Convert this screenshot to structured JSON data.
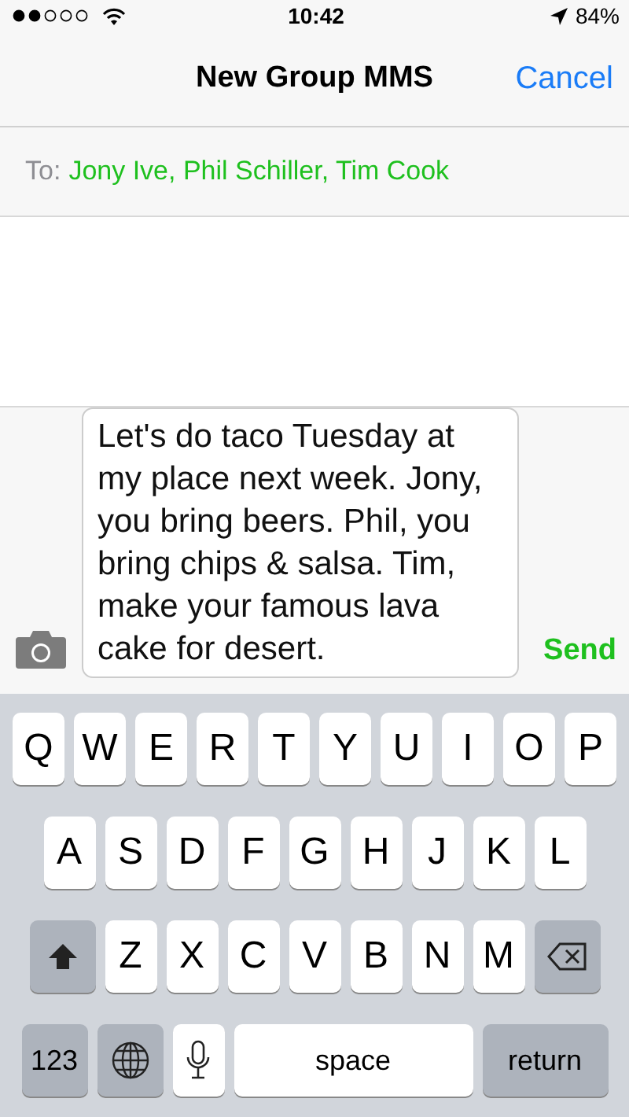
{
  "status_bar": {
    "time": "10:42",
    "battery": "84%"
  },
  "nav": {
    "title": "New Group MMS",
    "cancel": "Cancel"
  },
  "recipients": {
    "label": "To:",
    "names": "Jony Ive, Phil Schiller, Tim Cook"
  },
  "composer": {
    "message": "Let's do taco Tuesday at my place next week. Jony, you bring beers. Phil, you bring chips & salsa. Tim, make your famous lava cake for desert.",
    "send": "Send"
  },
  "keyboard": {
    "rows": [
      [
        {
          "kind": "letter",
          "label": "Q"
        },
        {
          "kind": "letter",
          "label": "W"
        },
        {
          "kind": "letter",
          "label": "E"
        },
        {
          "kind": "letter",
          "label": "R"
        },
        {
          "kind": "letter",
          "label": "T"
        },
        {
          "kind": "letter",
          "label": "Y"
        },
        {
          "kind": "letter",
          "label": "U"
        },
        {
          "kind": "letter",
          "label": "I"
        },
        {
          "kind": "letter",
          "label": "O"
        },
        {
          "kind": "letter",
          "label": "P"
        }
      ],
      [
        {
          "kind": "letter",
          "label": "A"
        },
        {
          "kind": "letter",
          "label": "S"
        },
        {
          "kind": "letter",
          "label": "D"
        },
        {
          "kind": "letter",
          "label": "F"
        },
        {
          "kind": "letter",
          "label": "G"
        },
        {
          "kind": "letter",
          "label": "H"
        },
        {
          "kind": "letter",
          "label": "J"
        },
        {
          "kind": "letter",
          "label": "K"
        },
        {
          "kind": "letter",
          "label": "L"
        }
      ],
      [
        {
          "kind": "shift"
        },
        {
          "kind": "letter",
          "label": "Z"
        },
        {
          "kind": "letter",
          "label": "X"
        },
        {
          "kind": "letter",
          "label": "C"
        },
        {
          "kind": "letter",
          "label": "V"
        },
        {
          "kind": "letter",
          "label": "B"
        },
        {
          "kind": "letter",
          "label": "N"
        },
        {
          "kind": "letter",
          "label": "M"
        },
        {
          "kind": "delete"
        }
      ]
    ],
    "bottom_row": [
      {
        "kind": "mode",
        "label": "123"
      },
      {
        "kind": "globe"
      },
      {
        "kind": "mic"
      },
      {
        "kind": "space",
        "label": "space"
      },
      {
        "kind": "return",
        "label": "return"
      }
    ]
  }
}
